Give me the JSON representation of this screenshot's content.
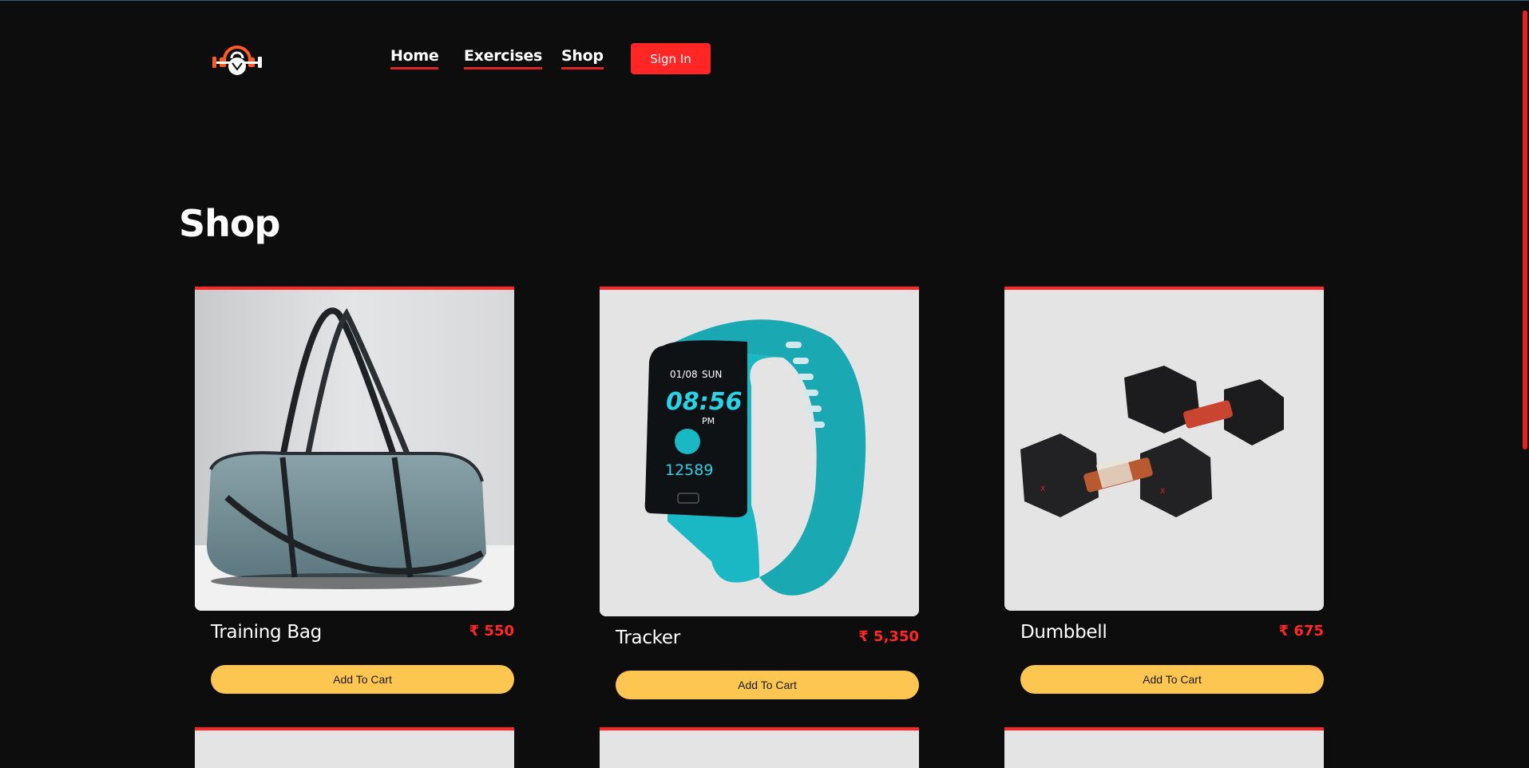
{
  "nav": {
    "logo_icon": "kettlebell-dumbbell-logo-icon",
    "links": [
      {
        "label": "Home"
      },
      {
        "label": "Exercises"
      },
      {
        "label": "Shop"
      }
    ],
    "signin_label": "Sign In"
  },
  "page": {
    "title": "Shop"
  },
  "products": [
    {
      "name": "Training Bag",
      "price": "₹ 550",
      "image_icon": "gym-bag-image",
      "button": "Add To Cart"
    },
    {
      "name": "Tracker",
      "price": "₹ 5,350",
      "image_icon": "fitness-tracker-image",
      "button": "Add To Cart",
      "watch_screen": {
        "date": "01/08",
        "day": "SUN",
        "time": "08:56",
        "ampm": "PM",
        "steps": "12589"
      }
    },
    {
      "name": "Dumbbell",
      "price": "₹ 675",
      "image_icon": "dumbbell-image",
      "button": "Add To Cart"
    }
  ],
  "colors": {
    "background": "#0d0d0e",
    "accent_red": "#ff2625",
    "button_yellow": "#fdc650",
    "card_bg": "#e4e4e4"
  }
}
